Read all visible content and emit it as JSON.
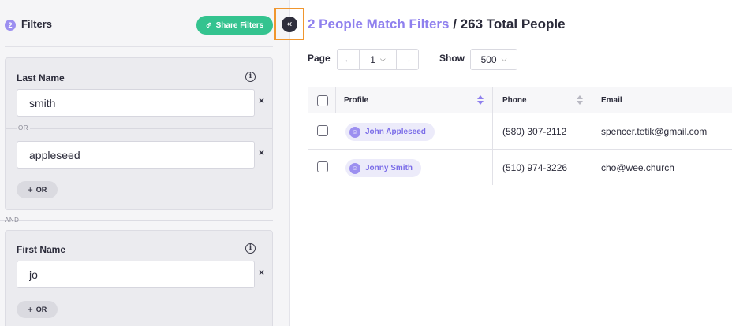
{
  "sidebar": {
    "filter_count": "2",
    "title": "Filters",
    "share_label": "Share Filters",
    "and_label": "AND",
    "filters": [
      {
        "title": "Last Name",
        "values": [
          "smith",
          "appleseed"
        ],
        "or_label": "OR",
        "add_or_label": "OR"
      },
      {
        "title": "First Name",
        "values": [
          "jo"
        ],
        "add_or_label": "OR"
      }
    ]
  },
  "header": {
    "match_text": "2 People Match Filters",
    "separator": " / ",
    "total_text": "263 Total People"
  },
  "pagination": {
    "page_label": "Page",
    "current_page": "1",
    "show_label": "Show",
    "show_value": "500"
  },
  "table": {
    "columns": [
      "Profile",
      "Phone",
      "Email"
    ],
    "rows": [
      {
        "name": "John Appleseed",
        "phone": "(580) 307-2112",
        "email": "spencer.tetik@gmail.com"
      },
      {
        "name": "Jonny Smith",
        "phone": "(510) 974-3226",
        "email": "cho@wee.church"
      }
    ]
  },
  "icons": {
    "link": "link-icon",
    "info": "info-icon",
    "collapse": "double-chevron-left-icon",
    "avatar": "person-icon"
  },
  "colors": {
    "accent": "#8f80ee",
    "share_button": "#34c38f",
    "highlight_frame": "#f0962e"
  }
}
